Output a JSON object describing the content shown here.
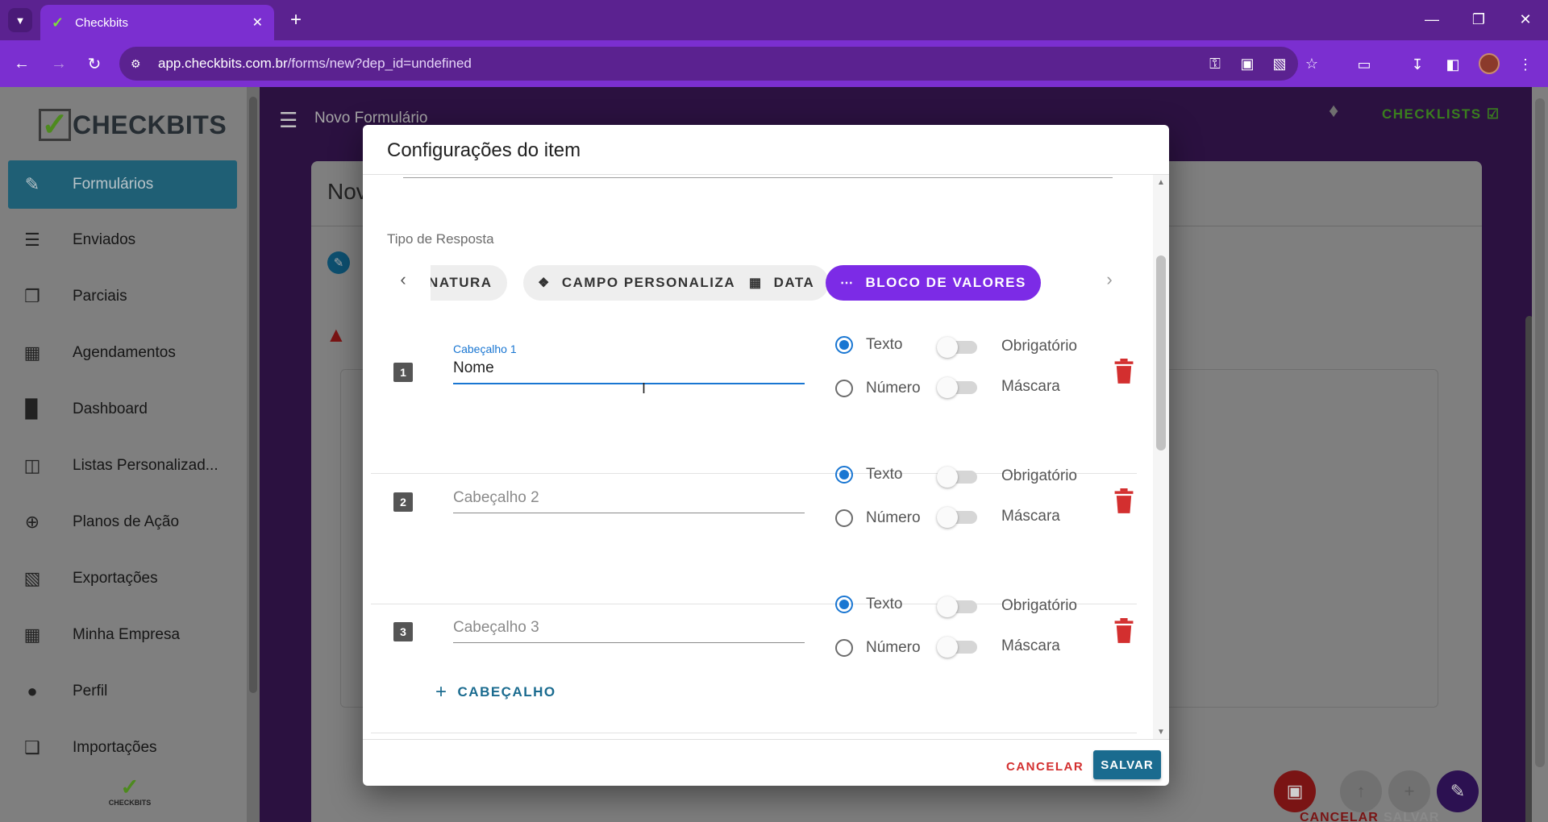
{
  "browser": {
    "tab_title": "Checkbits",
    "url_host": "app.checkbits.com.br",
    "url_path": "/forms/new?dep_id=undefined"
  },
  "sidebar": {
    "logo_text": "CHECKBITS",
    "bottom_logo_text": "CHECKBITS",
    "items": [
      {
        "label": "Formulários",
        "icon": "forms-icon"
      },
      {
        "label": "Enviados",
        "icon": "sent-icon"
      },
      {
        "label": "Parciais",
        "icon": "partial-icon"
      },
      {
        "label": "Agendamentos",
        "icon": "calendar-icon"
      },
      {
        "label": "Dashboard",
        "icon": "bar-chart-icon"
      },
      {
        "label": "Listas Personalizad...",
        "icon": "database-icon"
      },
      {
        "label": "Planos de Ação",
        "icon": "crosshair-icon"
      },
      {
        "label": "Exportações",
        "icon": "excel-icon"
      },
      {
        "label": "Minha Empresa",
        "icon": "building-icon"
      },
      {
        "label": "Perfil",
        "icon": "person-icon"
      },
      {
        "label": "Importações",
        "icon": "import-icon"
      }
    ]
  },
  "header": {
    "title": "Novo Formulário",
    "checklists_label": "CHECKLISTS"
  },
  "page": {
    "card_title": "Nov",
    "footer_cancel": "CANCELAR",
    "footer_save": "SALVAR"
  },
  "modal": {
    "title": "Configurações do item",
    "section_label": "Tipo de Resposta",
    "chips": [
      {
        "label": "SINATURA",
        "icon": "",
        "active": false
      },
      {
        "label": "CAMPO PERSONALIZADO",
        "icon": "tag-icon",
        "active": false
      },
      {
        "label": "DATA",
        "icon": "calendar-icon",
        "active": false
      },
      {
        "label": "BLOCO DE VALORES",
        "icon": "dots-icon",
        "active": true
      }
    ],
    "rows": [
      {
        "number": "1",
        "label": "Cabeçalho 1",
        "value": "Nome",
        "placeholder": "",
        "type_text": "Texto",
        "type_number": "Número",
        "selected": "text",
        "required_label": "Obrigatório",
        "mask_label": "Máscara"
      },
      {
        "number": "2",
        "label": "",
        "value": "",
        "placeholder": "Cabeçalho 2",
        "type_text": "Texto",
        "type_number": "Número",
        "selected": "text",
        "required_label": "Obrigatório",
        "mask_label": "Máscara"
      },
      {
        "number": "3",
        "label": "",
        "value": "",
        "placeholder": "Cabeçalho 3",
        "type_text": "Texto",
        "type_number": "Número",
        "selected": "text",
        "required_label": "Obrigatório",
        "mask_label": "Máscara"
      }
    ],
    "add_header_label": "CABEÇALHO",
    "cancel_label": "CANCELAR",
    "save_label": "SALVAR"
  },
  "colors": {
    "brand_purple": "#7b2fd0",
    "active_chip": "#7c2be6",
    "primary_blue": "#1976d2",
    "save_button": "#1a6b8f",
    "danger": "#d32f2f"
  }
}
